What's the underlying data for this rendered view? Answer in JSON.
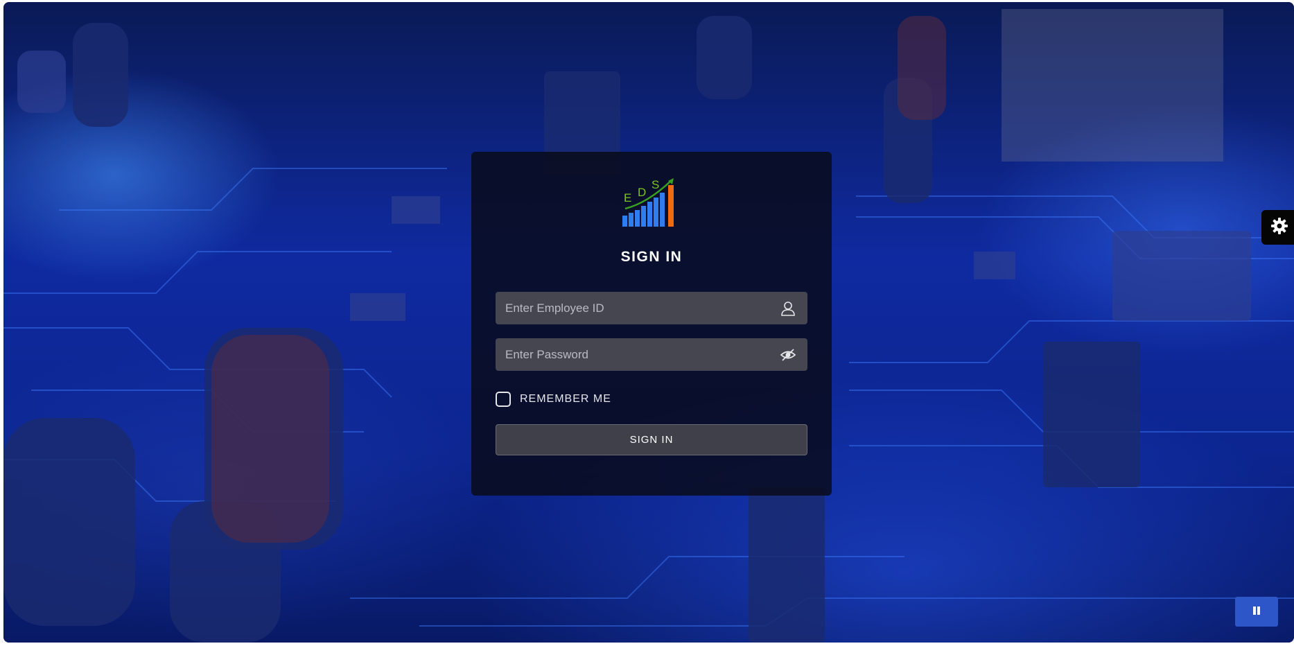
{
  "logo": {
    "letters": [
      "E",
      "D",
      "S"
    ],
    "colors": {
      "green": "#7cc520",
      "blue": "#2f7df0",
      "orange": "#f06a10"
    }
  },
  "card": {
    "title": "SIGN IN",
    "employee_id": {
      "value": "",
      "placeholder": "Enter Employee ID",
      "icon": "user-icon"
    },
    "password": {
      "value": "",
      "placeholder": "Enter Password",
      "icon": "eye-icon"
    },
    "remember_me": {
      "label": "REMEMBER ME",
      "checked": false
    },
    "submit_label": "SIGN IN"
  },
  "controls": {
    "settings_icon": "gear-icon",
    "video_icon": "pause-icon"
  },
  "colors": {
    "card_bg": "#080a16",
    "field_bg": "#45464f",
    "button_bg": "#3f4049",
    "accent_blue": "#2d56c8",
    "background_blue": "#0f2aa0"
  }
}
